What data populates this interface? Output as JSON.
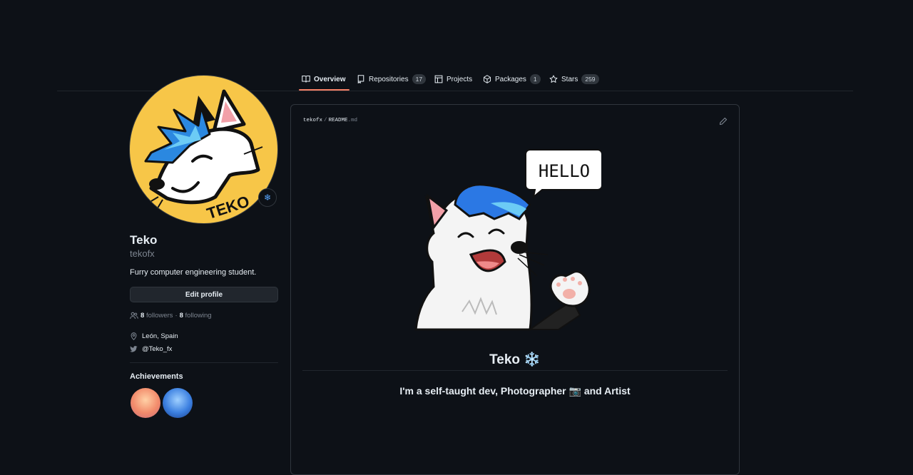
{
  "tabs": [
    {
      "label": "Overview",
      "icon": "book-icon"
    },
    {
      "label": "Repositories",
      "count": "17",
      "icon": "repo-icon"
    },
    {
      "label": "Projects",
      "icon": "table-icon"
    },
    {
      "label": "Packages",
      "count": "1",
      "icon": "package-icon"
    },
    {
      "label": "Stars",
      "count": "259",
      "icon": "star-icon"
    }
  ],
  "profile": {
    "avatar_text": "TEKO",
    "status_emoji": "❄",
    "name": "Teko",
    "login": "tekofx",
    "bio": "Furry computer engineering student.",
    "edit_label": "Edit profile",
    "followers_count": "8",
    "followers_label": "followers",
    "separator": "·",
    "following_count": "8",
    "following_label": "following",
    "location": "León, Spain",
    "twitter": "@Teko_fx",
    "achievements_title": "Achievements"
  },
  "readme": {
    "owner": "tekofx",
    "separator": "/",
    "file": "README",
    "ext": ".md",
    "speech_bubble": "HELLO",
    "title": "Teko ❄️",
    "subtitle": "I'm a self-taught dev, Photographer 📷 and Artist"
  },
  "colors": {
    "background": "#0d1117",
    "accent_underline": "#f78166",
    "avatar_bg": "#f7c648",
    "link_blue": "#58a6ff"
  }
}
